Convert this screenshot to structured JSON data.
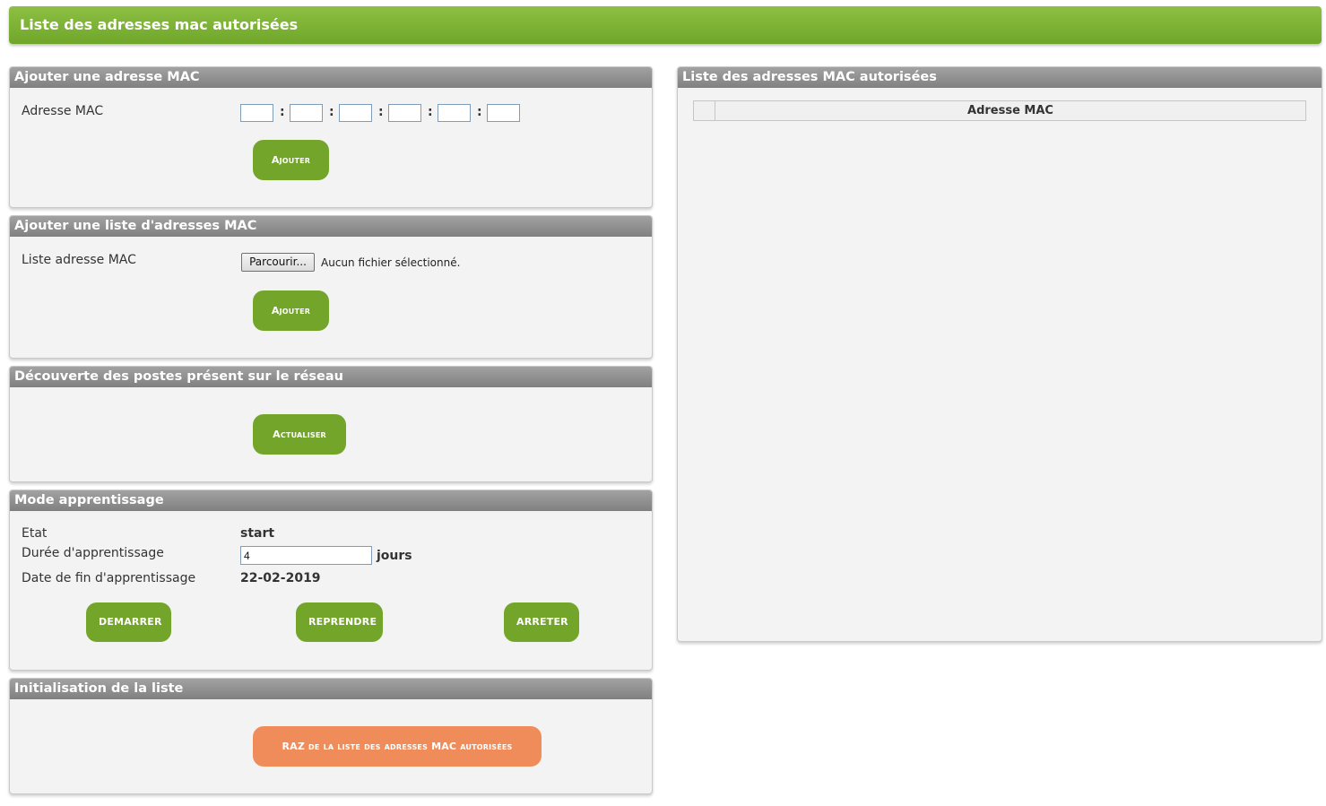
{
  "header": {
    "title": "Liste des adresses mac autorisées"
  },
  "add_mac": {
    "title": "Ajouter une adresse MAC",
    "label": "Adresse MAC",
    "separator": ":",
    "button": "Ajouter"
  },
  "add_list": {
    "title": "Ajouter une liste d'adresses MAC",
    "label": "Liste adresse MAC",
    "browse": "Parcourir...",
    "no_file": "Aucun fichier sélectionné.",
    "button": "Ajouter"
  },
  "discovery": {
    "title": "Découverte des postes présent sur le réseau",
    "button": "Actualiser"
  },
  "learning": {
    "title": "Mode apprentissage",
    "state_label": "Etat",
    "state_value": "start",
    "duration_label": "Durée d'apprentissage",
    "duration_value": "4",
    "duration_unit": "jours",
    "end_label": "Date de fin d'apprentissage",
    "end_value": "22-02-2019",
    "start_button": "DEMARRER",
    "resume_button": "REPRENDRE",
    "stop_button": "ARRETER"
  },
  "reset": {
    "title": "Initialisation de la liste",
    "button": "RAZ de la liste des adresses MAC autorisées"
  },
  "list_panel": {
    "title": "Liste des adresses MAC autorisées",
    "column": "Adresse MAC"
  },
  "colors": {
    "accent_green": "#74a52b",
    "reset_orange": "#ef8c5a",
    "header_grey": "#8f8f8f"
  }
}
